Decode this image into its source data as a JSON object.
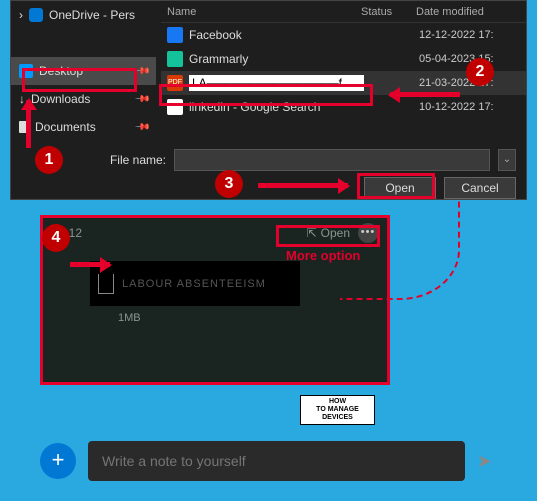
{
  "dialog": {
    "onedrive": "OneDrive - Pers",
    "desktop": "Desktop",
    "downloads": "Downloads",
    "documents": "Documents",
    "headers": {
      "name": "Name",
      "status": "Status",
      "date": "Date modified"
    },
    "files": [
      {
        "name": "Facebook",
        "date": "12-12-2022 17:"
      },
      {
        "name": "Grammarly",
        "date": "05-04-2023 15:"
      },
      {
        "name": "LA▬▬▬▬▬▬▬▬▬▬▬f",
        "date": "21-03-2022 17:"
      },
      {
        "name": "linkedin - Google Search",
        "date": "10-12-2022 17:"
      }
    ],
    "pdf_label": "PDF",
    "filename_label": "File name:",
    "open": "Open",
    "cancel": "Cancel"
  },
  "chat": {
    "time": "09:12",
    "open": "Open",
    "more_label": "More option",
    "att_name": "LABOUR ABSENTEEISM",
    "size": "1MB",
    "placeholder": "Write a note to yourself"
  },
  "logo": {
    "line1": "HOW",
    "line2": "TO MANAGE",
    "line3": "DEVICES"
  },
  "callouts": {
    "c1": "1",
    "c2": "2",
    "c3": "3",
    "c4": "4"
  }
}
